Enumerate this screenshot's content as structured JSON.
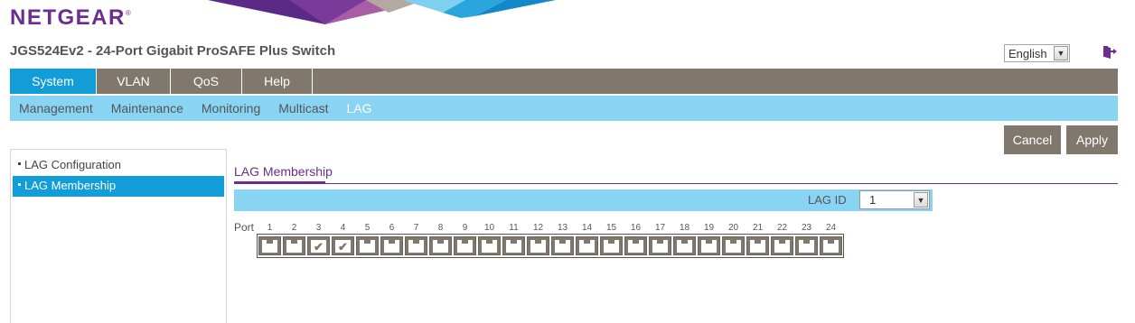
{
  "header": {
    "brand": "NETGEAR",
    "brand_mark": "®",
    "device_title": "JGS524Ev2 - 24-Port Gigabit ProSAFE Plus Switch",
    "language": "English",
    "logout_icon": "logout-icon"
  },
  "main_nav": [
    {
      "label": "System",
      "active": true
    },
    {
      "label": "VLAN",
      "active": false
    },
    {
      "label": "QoS",
      "active": false
    },
    {
      "label": "Help",
      "active": false
    }
  ],
  "sub_nav": [
    {
      "label": "Management",
      "active": false
    },
    {
      "label": "Maintenance",
      "active": false
    },
    {
      "label": "Monitoring",
      "active": false
    },
    {
      "label": "Multicast",
      "active": false
    },
    {
      "label": "LAG",
      "active": true
    }
  ],
  "buttons": {
    "cancel": "Cancel",
    "apply": "Apply"
  },
  "sidebar": [
    {
      "label": "LAG Configuration",
      "active": false
    },
    {
      "label": "LAG Membership",
      "active": true
    }
  ],
  "content": {
    "section_title": "LAG Membership",
    "lag_id_label": "LAG ID",
    "lag_id_value": "1",
    "port_label": "Port",
    "ports": [
      {
        "number": "1",
        "checked": false
      },
      {
        "number": "2",
        "checked": false
      },
      {
        "number": "3",
        "checked": true
      },
      {
        "number": "4",
        "checked": true
      },
      {
        "number": "5",
        "checked": false
      },
      {
        "number": "6",
        "checked": false
      },
      {
        "number": "7",
        "checked": false
      },
      {
        "number": "8",
        "checked": false
      },
      {
        "number": "9",
        "checked": false
      },
      {
        "number": "10",
        "checked": false
      },
      {
        "number": "11",
        "checked": false
      },
      {
        "number": "12",
        "checked": false
      },
      {
        "number": "13",
        "checked": false
      },
      {
        "number": "14",
        "checked": false
      },
      {
        "number": "15",
        "checked": false
      },
      {
        "number": "16",
        "checked": false
      },
      {
        "number": "17",
        "checked": false
      },
      {
        "number": "18",
        "checked": false
      },
      {
        "number": "19",
        "checked": false
      },
      {
        "number": "20",
        "checked": false
      },
      {
        "number": "21",
        "checked": false
      },
      {
        "number": "22",
        "checked": false
      },
      {
        "number": "23",
        "checked": false
      },
      {
        "number": "24",
        "checked": false
      }
    ]
  },
  "colors": {
    "brand_purple": "#6b2d8f",
    "nav_gray": "#81786d",
    "active_blue": "#139dd8",
    "subnav_light_blue": "#89d4f3"
  }
}
